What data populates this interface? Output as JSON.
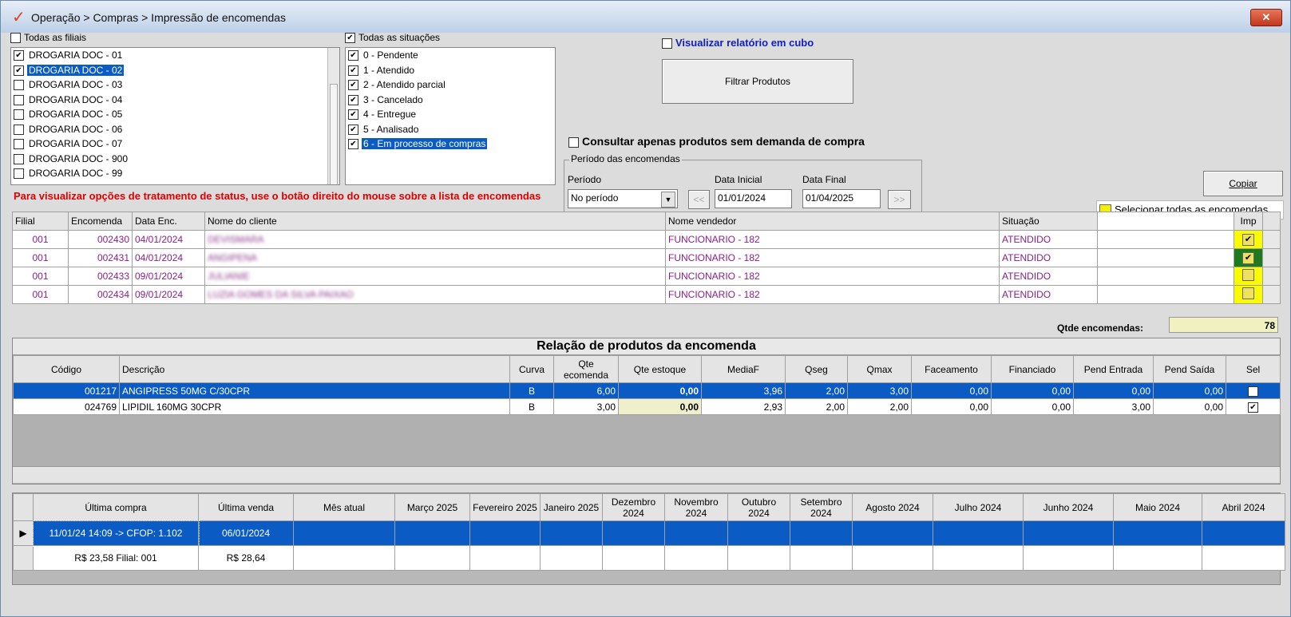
{
  "window": {
    "title": "Operação > Compras > Impressão de encomendas",
    "close_label": "✕"
  },
  "filiais": {
    "all_label": "Todas as filiais",
    "all_checked": false,
    "items": [
      {
        "label": "DROGARIA DOC - 01",
        "checked": true,
        "selected": false
      },
      {
        "label": "DROGARIA DOC - 02",
        "checked": true,
        "selected": true
      },
      {
        "label": "DROGARIA DOC - 03",
        "checked": false,
        "selected": false
      },
      {
        "label": "DROGARIA DOC - 04",
        "checked": false,
        "selected": false
      },
      {
        "label": "DROGARIA DOC - 05",
        "checked": false,
        "selected": false
      },
      {
        "label": "DROGARIA DOC - 06",
        "checked": false,
        "selected": false
      },
      {
        "label": "DROGARIA DOC - 07",
        "checked": false,
        "selected": false
      },
      {
        "label": "DROGARIA DOC - 900",
        "checked": false,
        "selected": false
      },
      {
        "label": "DROGARIA DOC - 99",
        "checked": false,
        "selected": false
      }
    ]
  },
  "situacoes": {
    "all_label": "Todas as situações",
    "all_checked": true,
    "items": [
      {
        "label": "0 - Pendente",
        "checked": true,
        "selected": false
      },
      {
        "label": "1 - Atendido",
        "checked": true,
        "selected": false
      },
      {
        "label": "2 - Atendido parcial",
        "checked": true,
        "selected": false
      },
      {
        "label": "3 - Cancelado",
        "checked": true,
        "selected": false
      },
      {
        "label": "4 - Entregue",
        "checked": true,
        "selected": false
      },
      {
        "label": "5 - Analisado",
        "checked": true,
        "selected": false
      },
      {
        "label": "6 - Em processo de compras",
        "checked": true,
        "selected": true
      }
    ]
  },
  "options": {
    "cubo_label": "Visualizar relatório em cubo",
    "filtrar_label": "Filtrar Produtos",
    "sem_demanda_label": "Consultar apenas produtos sem demanda de compra",
    "copiar_label": "Copiar",
    "selecionar_todas_label": "Selecionar todas as encomendas"
  },
  "periodo": {
    "group_title": "Período das encomendas",
    "periodo_label": "Período",
    "periodo_value": "No período",
    "data_inicial_label": "Data Inicial",
    "data_inicial_value": "01/01/2024",
    "data_final_label": "Data Final",
    "data_final_value": "01/04/2025",
    "prev_label": "<<",
    "next_label": ">>"
  },
  "note": "Para visualizar opções de tratamento de status, use o botão direito do mouse sobre a lista de encomendas",
  "orders": {
    "headers": [
      "Filial",
      "Encomenda",
      "Data Enc.",
      "Nome do cliente",
      "Nome vendedor",
      "Situação",
      "",
      "Imp"
    ],
    "rows": [
      {
        "filial": "001",
        "encomenda": "002430",
        "data": "04/01/2024",
        "cliente": "DEVISMARA",
        "vendedor": "FUNCIONARIO - 182",
        "situacao": "ATENDIDO",
        "imp": "checked-yellow"
      },
      {
        "filial": "001",
        "encomenda": "002431",
        "data": "04/01/2024",
        "cliente": "ANGIPENA",
        "vendedor": "FUNCIONARIO - 182",
        "situacao": "ATENDIDO",
        "imp": "checked-green"
      },
      {
        "filial": "001",
        "encomenda": "002433",
        "data": "09/01/2024",
        "cliente": "JULIANIE",
        "vendedor": "FUNCIONARIO - 182",
        "situacao": "ATENDIDO",
        "imp": "unchecked"
      },
      {
        "filial": "001",
        "encomenda": "002434",
        "data": "09/01/2024",
        "cliente": "LUZIA GOMES DA SILVA PAIXAO",
        "vendedor": "FUNCIONARIO - 182",
        "situacao": "ATENDIDO",
        "imp": "unchecked"
      }
    ],
    "qtde_label": "Qtde encomendas:",
    "qtde_value": "78"
  },
  "produtos": {
    "title": "Relação de produtos da encomenda",
    "headers": [
      "Código",
      "Descrição",
      "Curva",
      "Qte ecomenda",
      "Qte estoque",
      "MediaF",
      "Qseg",
      "Qmax",
      "Faceamento",
      "Financiado",
      "Pend Entrada",
      "Pend Saída",
      "Sel"
    ],
    "rows": [
      {
        "codigo": "001217",
        "descricao": "ANGIPRESS 50MG C/30CPR",
        "curva": "B",
        "qte_encomenda": "6,00",
        "qte_estoque": "0,00",
        "mediaf": "3,96",
        "qseg": "2,00",
        "qmax": "3,00",
        "faceamento": "0,00",
        "financiado": "0,00",
        "pend_entrada": "0,00",
        "pend_saida": "0,00",
        "sel": true
      },
      {
        "codigo": "024769",
        "descricao": "LIPIDIL 160MG 30CPR",
        "curva": "B",
        "qte_encomenda": "3,00",
        "qte_estoque": "0,00",
        "mediaf": "2,93",
        "qseg": "2,00",
        "qmax": "2,00",
        "faceamento": "0,00",
        "financiado": "0,00",
        "pend_entrada": "3,00",
        "pend_saida": "0,00",
        "sel": true
      }
    ]
  },
  "historico": {
    "headers": [
      "Última compra",
      "Última venda",
      "Mês atual",
      "Março 2025",
      "Fevereiro 2025",
      "Janeiro 2025",
      "Dezembro 2024",
      "Novembro 2024",
      "Outubro 2024",
      "Setembro 2024",
      "Agosto 2024",
      "Julho 2024",
      "Junho 2024",
      "Maio 2024",
      "Abril 2024"
    ],
    "row1": {
      "ultima_compra": "11/01/24 14:09 -> CFOP: 1.102",
      "ultima_venda": "06/01/2024"
    },
    "row2": {
      "ultima_compra": "R$ 23,58 Filial: 001",
      "ultima_venda": "R$ 28,64"
    },
    "row_indicator": "▶"
  }
}
